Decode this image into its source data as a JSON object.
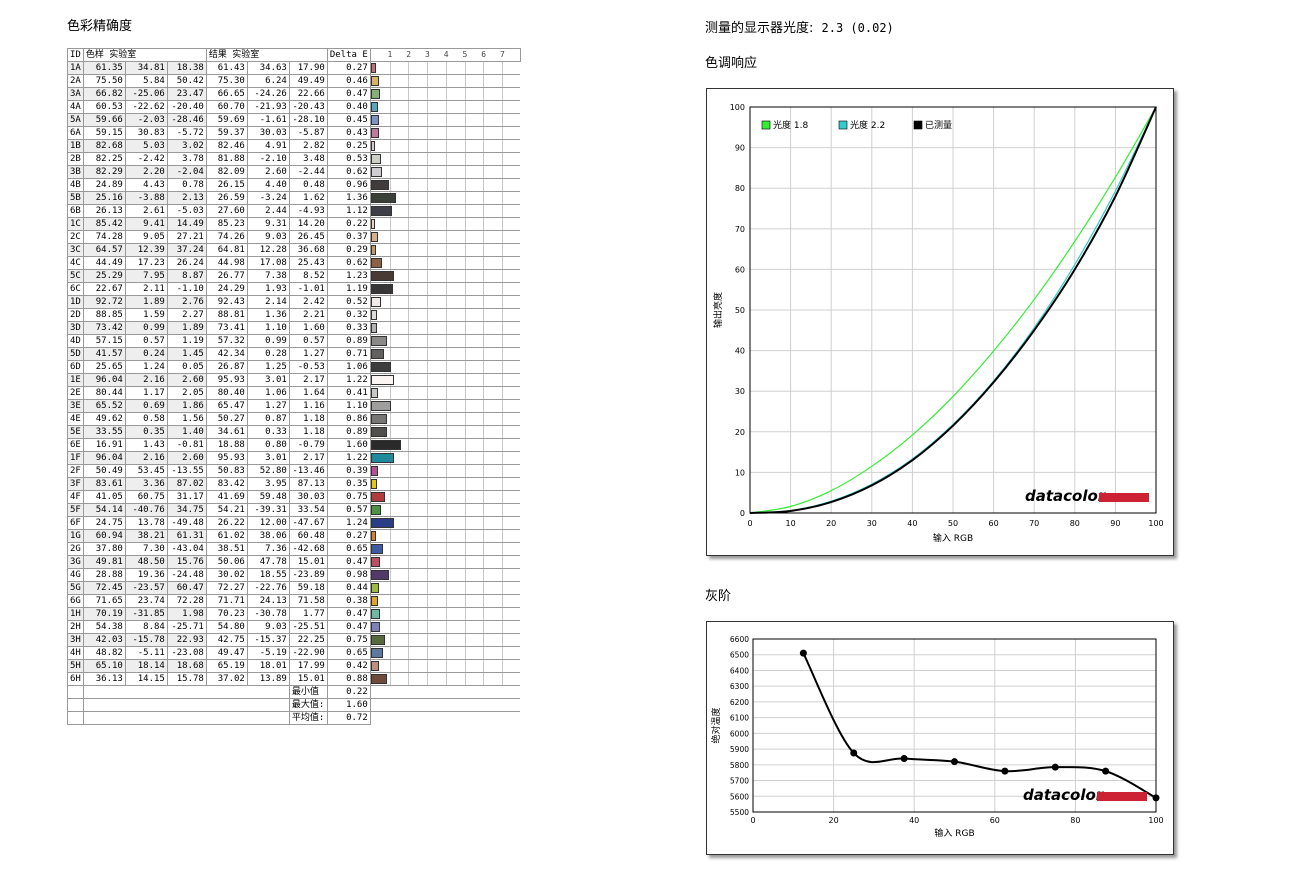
{
  "page": {
    "left_title": "色彩精确度",
    "gamma_text_label": "测量的显示器光度:",
    "gamma_text_value": "2.3 (0.02)",
    "tone_title": "色调响应",
    "gray_title": "灰阶"
  },
  "colors": {
    "gamma18": "#33ee33",
    "gamma22": "#33cccc",
    "measured": "#000000",
    "brand_red": "#cc2233"
  },
  "table": {
    "headers": {
      "id": "ID",
      "sample": "色样 实验室",
      "result": "结果 实验室",
      "delta": "Delta E"
    },
    "scale_ticks": [
      "1",
      "2",
      "3",
      "4",
      "5",
      "6",
      "7"
    ],
    "rows": [
      {
        "id": "1A",
        "s": [
          "61.35",
          "34.81",
          "18.38"
        ],
        "r": [
          "61.43",
          "34.63",
          "17.90"
        ],
        "de": "0.27",
        "color": "#c46f7a"
      },
      {
        "id": "2A",
        "s": [
          "75.50",
          "5.84",
          "50.42"
        ],
        "r": [
          "75.30",
          "6.24",
          "49.49"
        ],
        "de": "0.46",
        "color": "#d5b46a"
      },
      {
        "id": "3A",
        "s": [
          "66.82",
          "-25.06",
          "23.47"
        ],
        "r": [
          "66.65",
          "-24.26",
          "22.66"
        ],
        "de": "0.47",
        "color": "#86b077"
      },
      {
        "id": "4A",
        "s": [
          "60.53",
          "-22.62",
          "-20.40"
        ],
        "r": [
          "60.70",
          "-21.93",
          "-20.43"
        ],
        "de": "0.40",
        "color": "#55a6c0"
      },
      {
        "id": "5A",
        "s": [
          "59.66",
          "-2.03",
          "-28.46"
        ],
        "r": [
          "59.69",
          "-1.61",
          "-28.10"
        ],
        "de": "0.45",
        "color": "#7f92c4"
      },
      {
        "id": "6A",
        "s": [
          "59.15",
          "30.83",
          "-5.72"
        ],
        "r": [
          "59.37",
          "30.03",
          "-5.87"
        ],
        "de": "0.43",
        "color": "#c07a9c"
      },
      {
        "id": "1B",
        "s": [
          "82.68",
          "5.03",
          "3.02"
        ],
        "r": [
          "82.46",
          "4.91",
          "2.82"
        ],
        "de": "0.25",
        "color": "#d8ccca"
      },
      {
        "id": "2B",
        "s": [
          "82.25",
          "-2.42",
          "3.78"
        ],
        "r": [
          "81.88",
          "-2.10",
          "3.48"
        ],
        "de": "0.53",
        "color": "#ccd0c6"
      },
      {
        "id": "3B",
        "s": [
          "82.29",
          "2.20",
          "-2.04"
        ],
        "r": [
          "82.09",
          "2.60",
          "-2.44"
        ],
        "de": "0.62",
        "color": "#d0cdd2"
      },
      {
        "id": "4B",
        "s": [
          "24.89",
          "4.43",
          "0.78"
        ],
        "r": [
          "26.15",
          "4.40",
          "0.48"
        ],
        "de": "0.96",
        "color": "#413c3b"
      },
      {
        "id": "5B",
        "s": [
          "25.16",
          "-3.88",
          "2.13"
        ],
        "r": [
          "26.59",
          "-3.24",
          "1.62"
        ],
        "de": "1.36",
        "color": "#3a3f38"
      },
      {
        "id": "6B",
        "s": [
          "26.13",
          "2.61",
          "-5.03"
        ],
        "r": [
          "27.60",
          "2.44",
          "-4.93"
        ],
        "de": "1.12",
        "color": "#3e3e48"
      },
      {
        "id": "1C",
        "s": [
          "85.42",
          "9.41",
          "14.49"
        ],
        "r": [
          "85.23",
          "9.31",
          "14.20"
        ],
        "de": "0.22",
        "color": "#efd3c0"
      },
      {
        "id": "2C",
        "s": [
          "74.28",
          "9.05",
          "27.21"
        ],
        "r": [
          "74.26",
          "9.03",
          "26.45"
        ],
        "de": "0.37",
        "color": "#d6b08a"
      },
      {
        "id": "3C",
        "s": [
          "64.57",
          "12.39",
          "37.24"
        ],
        "r": [
          "64.81",
          "12.28",
          "36.68"
        ],
        "de": "0.29",
        "color": "#c19866"
      },
      {
        "id": "4C",
        "s": [
          "44.49",
          "17.23",
          "26.24"
        ],
        "r": [
          "44.98",
          "17.08",
          "25.43"
        ],
        "de": "0.62",
        "color": "#8c6143"
      },
      {
        "id": "5C",
        "s": [
          "25.29",
          "7.95",
          "8.87"
        ],
        "r": [
          "26.77",
          "7.38",
          "8.52"
        ],
        "de": "1.23",
        "color": "#4a3a34"
      },
      {
        "id": "6C",
        "s": [
          "22.67",
          "2.11",
          "-1.10"
        ],
        "r": [
          "24.29",
          "1.93",
          "-1.01"
        ],
        "de": "1.19",
        "color": "#393638"
      },
      {
        "id": "1D",
        "s": [
          "92.72",
          "1.89",
          "2.76"
        ],
        "r": [
          "92.43",
          "2.14",
          "2.42"
        ],
        "de": "0.52",
        "color": "#f0ebe9"
      },
      {
        "id": "2D",
        "s": [
          "88.85",
          "1.59",
          "2.27"
        ],
        "r": [
          "88.81",
          "1.36",
          "2.21"
        ],
        "de": "0.32",
        "color": "#e0dcda"
      },
      {
        "id": "3D",
        "s": [
          "73.42",
          "0.99",
          "1.89"
        ],
        "r": [
          "73.41",
          "1.10",
          "1.60"
        ],
        "de": "0.33",
        "color": "#b5b3b1"
      },
      {
        "id": "4D",
        "s": [
          "57.15",
          "0.57",
          "1.19"
        ],
        "r": [
          "57.32",
          "0.99",
          "0.57"
        ],
        "de": "0.89",
        "color": "#8a8988"
      },
      {
        "id": "5D",
        "s": [
          "41.57",
          "0.24",
          "1.45"
        ],
        "r": [
          "42.34",
          "0.28",
          "1.27"
        ],
        "de": "0.71",
        "color": "#626160"
      },
      {
        "id": "6D",
        "s": [
          "25.65",
          "1.24",
          "0.05"
        ],
        "r": [
          "26.87",
          "1.25",
          "-0.53"
        ],
        "de": "1.06",
        "color": "#3e3d3d"
      },
      {
        "id": "1E",
        "s": [
          "96.04",
          "2.16",
          "2.60"
        ],
        "r": [
          "95.93",
          "3.01",
          "2.17"
        ],
        "de": "1.22",
        "color": "#fbf6f4"
      },
      {
        "id": "2E",
        "s": [
          "80.44",
          "1.17",
          "2.05"
        ],
        "r": [
          "80.40",
          "1.06",
          "1.64"
        ],
        "de": "0.41",
        "color": "#c9c6c4"
      },
      {
        "id": "3E",
        "s": [
          "65.52",
          "0.69",
          "1.86"
        ],
        "r": [
          "65.47",
          "1.27",
          "1.16"
        ],
        "de": "1.10",
        "color": "#a09e9c"
      },
      {
        "id": "4E",
        "s": [
          "49.62",
          "0.58",
          "1.56"
        ],
        "r": [
          "50.27",
          "0.87",
          "1.18"
        ],
        "de": "0.86",
        "color": "#787675"
      },
      {
        "id": "5E",
        "s": [
          "33.55",
          "0.35",
          "1.40"
        ],
        "r": [
          "34.61",
          "0.33",
          "1.18"
        ],
        "de": "0.89",
        "color": "#504f4e"
      },
      {
        "id": "6E",
        "s": [
          "16.91",
          "1.43",
          "-0.81"
        ],
        "r": [
          "18.88",
          "0.80",
          "-0.79"
        ],
        "de": "1.60",
        "color": "#2b2a2b"
      },
      {
        "id": "1F",
        "s": [
          "96.04",
          "2.16",
          "2.60"
        ],
        "r": [
          "95.93",
          "3.01",
          "2.17"
        ],
        "de": "1.22",
        "color": "#1e8a9c"
      },
      {
        "id": "2F",
        "s": [
          "50.49",
          "53.45",
          "-13.55"
        ],
        "r": [
          "50.83",
          "52.80",
          "-13.46"
        ],
        "de": "0.39",
        "color": "#b84f93"
      },
      {
        "id": "3F",
        "s": [
          "83.61",
          "3.36",
          "87.02"
        ],
        "r": [
          "83.42",
          "3.95",
          "87.13"
        ],
        "de": "0.35",
        "color": "#e0c81a"
      },
      {
        "id": "4F",
        "s": [
          "41.05",
          "60.75",
          "31.17"
        ],
        "r": [
          "41.69",
          "59.48",
          "30.03"
        ],
        "de": "0.75",
        "color": "#b13c3f"
      },
      {
        "id": "5F",
        "s": [
          "54.14",
          "-40.76",
          "34.75"
        ],
        "r": [
          "54.21",
          "-39.31",
          "33.54"
        ],
        "de": "0.57",
        "color": "#4c9346"
      },
      {
        "id": "6F",
        "s": [
          "24.75",
          "13.78",
          "-49.48"
        ],
        "r": [
          "26.22",
          "12.00",
          "-47.67"
        ],
        "de": "1.24",
        "color": "#2a3e86"
      },
      {
        "id": "1G",
        "s": [
          "60.94",
          "38.21",
          "61.31"
        ],
        "r": [
          "61.02",
          "38.06",
          "60.48"
        ],
        "de": "0.27",
        "color": "#d9812b"
      },
      {
        "id": "2G",
        "s": [
          "37.80",
          "7.30",
          "-43.04"
        ],
        "r": [
          "38.51",
          "7.36",
          "-42.68"
        ],
        "de": "0.65",
        "color": "#3f5aa3"
      },
      {
        "id": "3G",
        "s": [
          "49.81",
          "48.50",
          "15.76"
        ],
        "r": [
          "50.06",
          "47.78",
          "15.01"
        ],
        "de": "0.47",
        "color": "#bd4f63"
      },
      {
        "id": "4G",
        "s": [
          "28.88",
          "19.36",
          "-24.48"
        ],
        "r": [
          "30.02",
          "18.55",
          "-23.89"
        ],
        "de": "0.98",
        "color": "#53386a"
      },
      {
        "id": "5G",
        "s": [
          "72.45",
          "-23.57",
          "60.47"
        ],
        "r": [
          "72.27",
          "-22.76",
          "59.18"
        ],
        "de": "0.44",
        "color": "#9fba43"
      },
      {
        "id": "6G",
        "s": [
          "71.65",
          "23.74",
          "72.28"
        ],
        "r": [
          "71.71",
          "24.13",
          "71.58"
        ],
        "de": "0.38",
        "color": "#e3a32b"
      },
      {
        "id": "1H",
        "s": [
          "70.19",
          "-31.85",
          "1.98"
        ],
        "r": [
          "70.23",
          "-30.78",
          "1.77"
        ],
        "de": "0.47",
        "color": "#6fbaa3"
      },
      {
        "id": "2H",
        "s": [
          "54.38",
          "8.84",
          "-25.71"
        ],
        "r": [
          "54.80",
          "9.03",
          "-25.51"
        ],
        "de": "0.47",
        "color": "#7e82b6"
      },
      {
        "id": "3H",
        "s": [
          "42.03",
          "-15.78",
          "22.93"
        ],
        "r": [
          "42.75",
          "-15.37",
          "22.25"
        ],
        "de": "0.75",
        "color": "#576a3d"
      },
      {
        "id": "4H",
        "s": [
          "48.82",
          "-5.11",
          "-23.08"
        ],
        "r": [
          "49.47",
          "-5.19",
          "-22.90"
        ],
        "de": "0.65",
        "color": "#5d799e"
      },
      {
        "id": "5H",
        "s": [
          "65.10",
          "18.14",
          "18.68"
        ],
        "r": [
          "65.19",
          "18.01",
          "17.99"
        ],
        "de": "0.42",
        "color": "#be8f7f"
      },
      {
        "id": "6H",
        "s": [
          "36.13",
          "14.15",
          "15.78"
        ],
        "r": [
          "37.02",
          "13.89",
          "15.01"
        ],
        "de": "0.88",
        "color": "#6f4b3c"
      }
    ],
    "summary": [
      {
        "label": "最小值",
        "value": "0.22"
      },
      {
        "label": "最大值:",
        "value": "1.60"
      },
      {
        "label": "平均值:",
        "value": "0.72"
      }
    ]
  },
  "brand": {
    "logo_text": "datacolor"
  },
  "chart_data": [
    {
      "type": "line",
      "title": "色调响应",
      "xlabel": "输入 RGB",
      "ylabel": "输出亮度",
      "xlim": [
        0,
        100
      ],
      "ylim": [
        0,
        100
      ],
      "xticks": [
        "0",
        "10",
        "20",
        "30",
        "40",
        "50",
        "60",
        "70",
        "80",
        "90",
        "100"
      ],
      "yticks": [
        "0",
        "10",
        "20",
        "30",
        "40",
        "50",
        "60",
        "70",
        "80",
        "90",
        "100"
      ],
      "grid": true,
      "legend_position": "top-left",
      "series": [
        {
          "name": "光度 1.8",
          "color": "#33ee33",
          "x": [
            0,
            10,
            20,
            30,
            40,
            50,
            60,
            70,
            80,
            90,
            100
          ],
          "y": [
            0,
            1.6,
            5.5,
            11.5,
            19.2,
            28.7,
            39.9,
            52.6,
            66.9,
            82.7,
            100
          ]
        },
        {
          "name": "光度 2.2",
          "color": "#33cccc",
          "x": [
            0,
            10,
            20,
            30,
            40,
            50,
            60,
            70,
            80,
            90,
            100
          ],
          "y": [
            0,
            0.6,
            2.9,
            7.1,
            13.3,
            21.8,
            32.5,
            45.6,
            61.2,
            79.3,
            100
          ]
        },
        {
          "name": "已测量",
          "color": "#000000",
          "x": [
            0,
            10,
            20,
            30,
            40,
            50,
            60,
            70,
            80,
            90,
            100
          ],
          "y": [
            0,
            0.5,
            2.7,
            6.8,
            13.0,
            21.5,
            32.2,
            45.0,
            60.0,
            78.0,
            100
          ]
        }
      ]
    },
    {
      "type": "line",
      "title": "灰阶",
      "xlabel": "输入 RGB",
      "ylabel": "绝对温度",
      "xlim": [
        0,
        100
      ],
      "ylim": [
        5500,
        6600
      ],
      "xticks": [
        "0",
        "20",
        "40",
        "60",
        "80",
        "100"
      ],
      "yticks": [
        "5500",
        "5600",
        "5700",
        "5800",
        "5900",
        "6000",
        "6100",
        "6200",
        "6300",
        "6400",
        "6500",
        "6600"
      ],
      "grid": true,
      "series": [
        {
          "name": "",
          "color": "#000000",
          "x": [
            12.5,
            25,
            37.5,
            50,
            62.5,
            75,
            87.5,
            100
          ],
          "y": [
            6510,
            5875,
            5840,
            5820,
            5760,
            5785,
            5760,
            5590
          ]
        }
      ]
    }
  ]
}
